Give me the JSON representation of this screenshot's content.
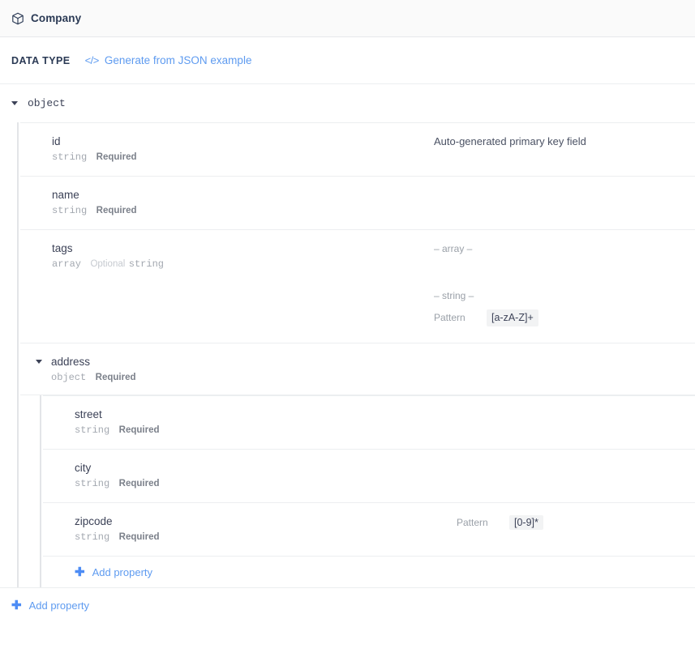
{
  "header": {
    "icon": "cube-icon",
    "title": "Company"
  },
  "datatype_bar": {
    "label": "DATA TYPE",
    "generate_link": {
      "icon": "code-icon",
      "icon_glyph": "</>",
      "label": "Generate from JSON example"
    }
  },
  "accent_color": "#5e9bf0",
  "tree": {
    "root": {
      "type": "object",
      "expanded": true
    },
    "properties": [
      {
        "name": "id",
        "type": "string",
        "flag": "Required",
        "description": "Auto-generated primary key field"
      },
      {
        "name": "name",
        "type": "string",
        "flag": "Required",
        "description": ""
      },
      {
        "name": "tags",
        "type": "array",
        "flag": "Optional",
        "item_type": "string",
        "array_label": "– array –",
        "item_label": "– string –",
        "constraint_key": "Pattern",
        "constraint_value": "[a-zA-Z]+"
      },
      {
        "name": "address",
        "type": "object",
        "flag": "Required",
        "expanded": true,
        "children": [
          {
            "name": "street",
            "type": "string",
            "flag": "Required"
          },
          {
            "name": "city",
            "type": "string",
            "flag": "Required"
          },
          {
            "name": "zipcode",
            "type": "string",
            "flag": "Required",
            "constraint_key": "Pattern",
            "constraint_value": "[0-9]*"
          }
        ],
        "add_property_label": "Add property"
      }
    ],
    "add_property_label": "Add property"
  }
}
